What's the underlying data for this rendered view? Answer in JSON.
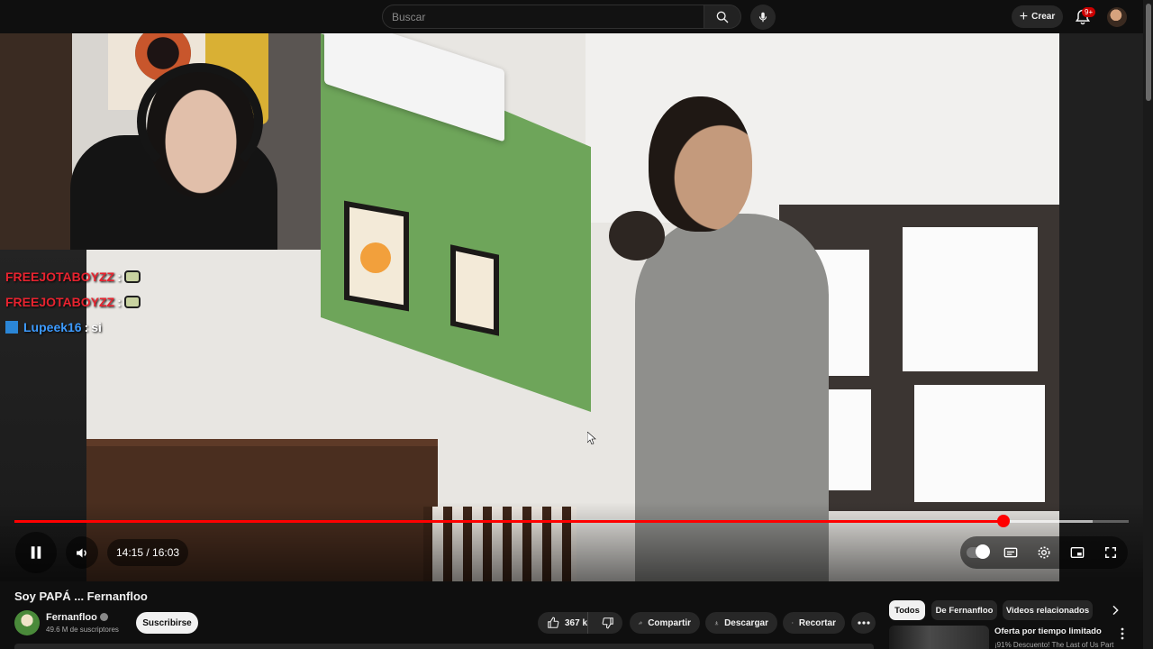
{
  "search": {
    "placeholder": "Buscar"
  },
  "header": {
    "create_label": "Crear",
    "notifications_badge": "9+"
  },
  "stream_chat": [
    {
      "user": "FREEJOTABOYZZ",
      "separator": ":",
      "emote": "emote"
    },
    {
      "user": "FREEJOTABOYZZ",
      "separator": ":",
      "emote": "emote"
    },
    {
      "user": "Lupeek16",
      "separator": ":",
      "text": "si"
    }
  ],
  "player": {
    "time_display": "14:15 / 16:03",
    "progress_fraction": 0.888,
    "buffered_fraction": 0.968,
    "state": "playing"
  },
  "video": {
    "title": "Soy PAPÁ ... Fernanfloo",
    "channel_name": "Fernanfloo",
    "subscribers": "49.6 M de suscriptores",
    "subscribe_label": "Suscribirse",
    "likes": "367 k",
    "share_label": "Compartir",
    "download_label": "Descargar",
    "clip_label": "Recortar"
  },
  "related_chips": [
    {
      "label": "Todos",
      "active": true
    },
    {
      "label": "De Fernanfloo",
      "active": false
    },
    {
      "label": "Videos relacionados",
      "active": false
    }
  ],
  "recommendation": {
    "title": "Oferta por tiempo limitado",
    "subtitle": "¡91% Descuento! The Last of Us Part"
  },
  "colors": {
    "accent": "#ff0000",
    "background": "#0f0f0f",
    "surface": "#272727"
  },
  "icons": [
    "search-icon",
    "mic-icon",
    "plus-icon",
    "bell-icon",
    "pause-icon",
    "volume-icon",
    "autoplay-toggle-icon",
    "subtitles-icon",
    "settings-icon",
    "miniplayer-icon",
    "fullscreen-icon",
    "like-icon",
    "dislike-icon",
    "share-icon",
    "download-icon",
    "scissors-icon",
    "more-icon",
    "chevron-right-icon",
    "kebab-icon"
  ]
}
